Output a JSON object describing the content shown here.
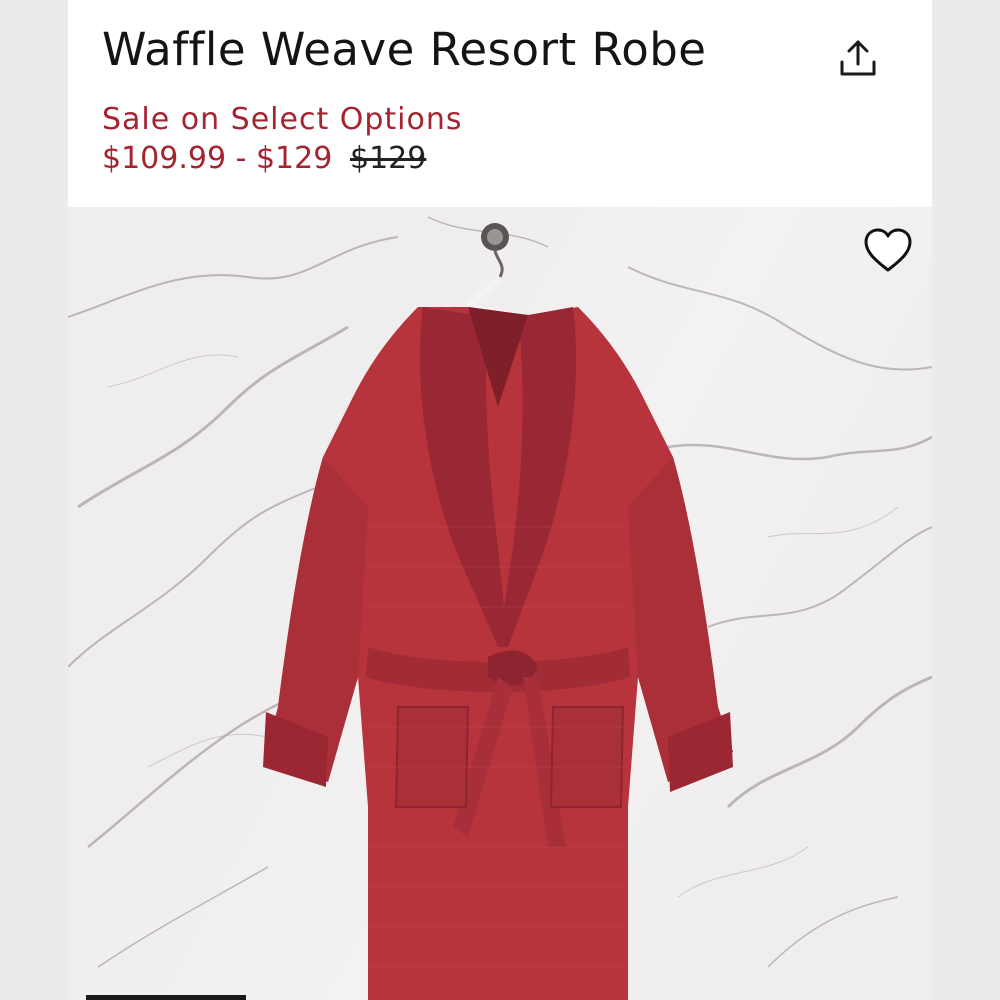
{
  "product": {
    "title": "Waffle Weave Resort Robe",
    "sale_label": "Sale on Select Options",
    "price_range": "$109.99 - $129",
    "original_price": "$129"
  },
  "icons": {
    "share": "share-upload-icon",
    "wishlist": "heart-outline-icon"
  },
  "colors": {
    "sale": "#a52430",
    "robe": "#b7343d",
    "background_marble": "#efedee"
  }
}
